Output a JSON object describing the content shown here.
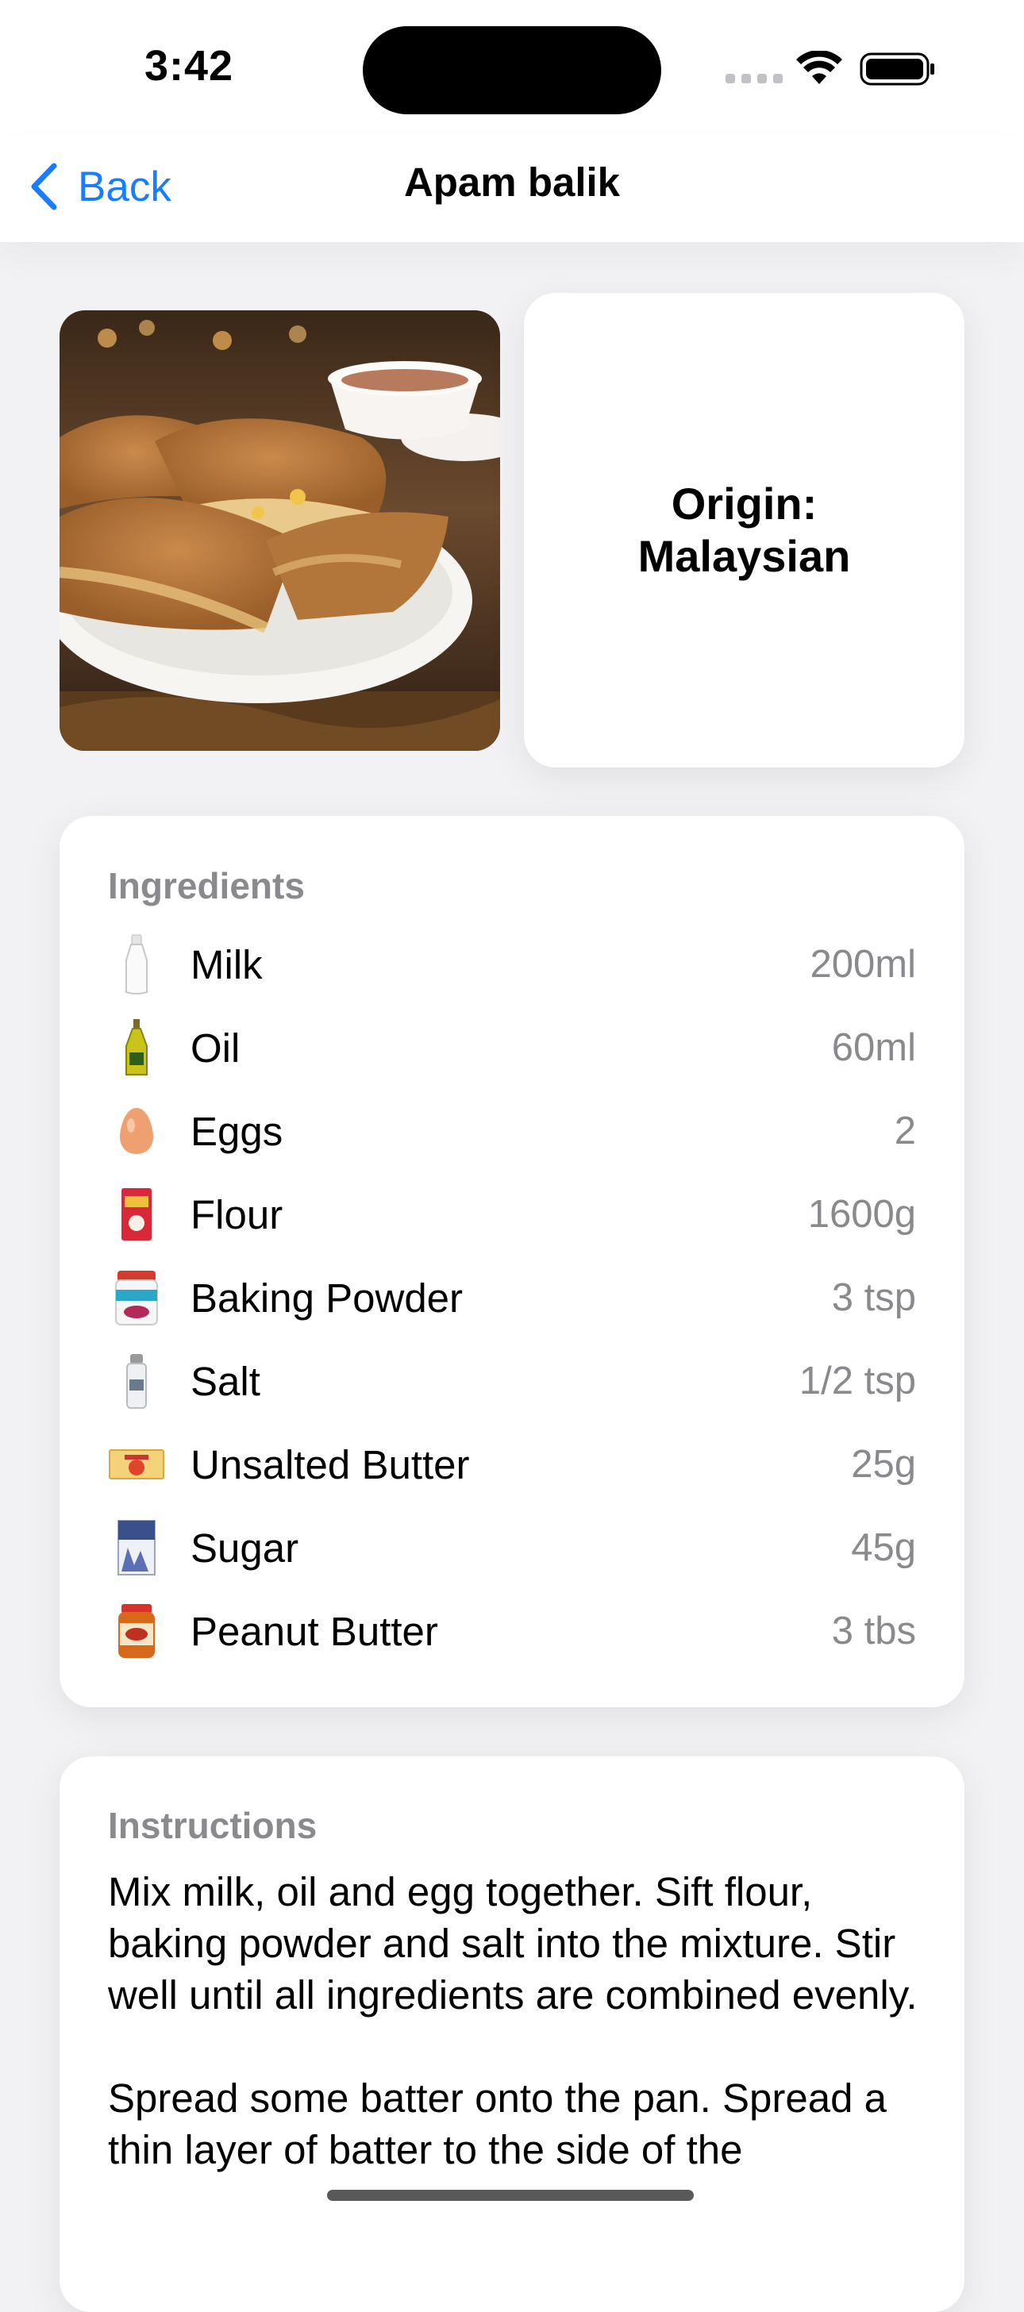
{
  "status_bar": {
    "time": "3:42"
  },
  "nav": {
    "back_label": "Back",
    "title": "Apam balik"
  },
  "origin": {
    "line1": "Origin:",
    "line2": "Malaysian"
  },
  "ingredients": {
    "header": "Ingredients",
    "items": [
      {
        "name": "Milk",
        "amount": "200ml",
        "icon": "milk-bottle-icon"
      },
      {
        "name": "Oil",
        "amount": "60ml",
        "icon": "oil-bottle-icon"
      },
      {
        "name": "Eggs",
        "amount": "2",
        "icon": "egg-icon"
      },
      {
        "name": "Flour",
        "amount": "1600g",
        "icon": "flour-bag-icon"
      },
      {
        "name": "Baking Powder",
        "amount": "3 tsp",
        "icon": "baking-powder-icon"
      },
      {
        "name": "Salt",
        "amount": "1/2 tsp",
        "icon": "salt-shaker-icon"
      },
      {
        "name": "Unsalted Butter",
        "amount": "25g",
        "icon": "butter-icon"
      },
      {
        "name": "Sugar",
        "amount": "45g",
        "icon": "sugar-box-icon"
      },
      {
        "name": "Peanut Butter",
        "amount": "3 tbs",
        "icon": "peanut-butter-jar-icon"
      }
    ]
  },
  "instructions": {
    "header": "Instructions",
    "text": "Mix milk, oil and egg together. Sift flour, baking powder and salt into the mixture. Stir well until all ingredients are combined evenly.\n\nSpread some batter onto the pan. Spread a thin layer of batter to the side of the"
  },
  "colors": {
    "accent": "#1a7dff",
    "secondary_text": "#8a8a8e",
    "background": "#f2f2f4"
  }
}
